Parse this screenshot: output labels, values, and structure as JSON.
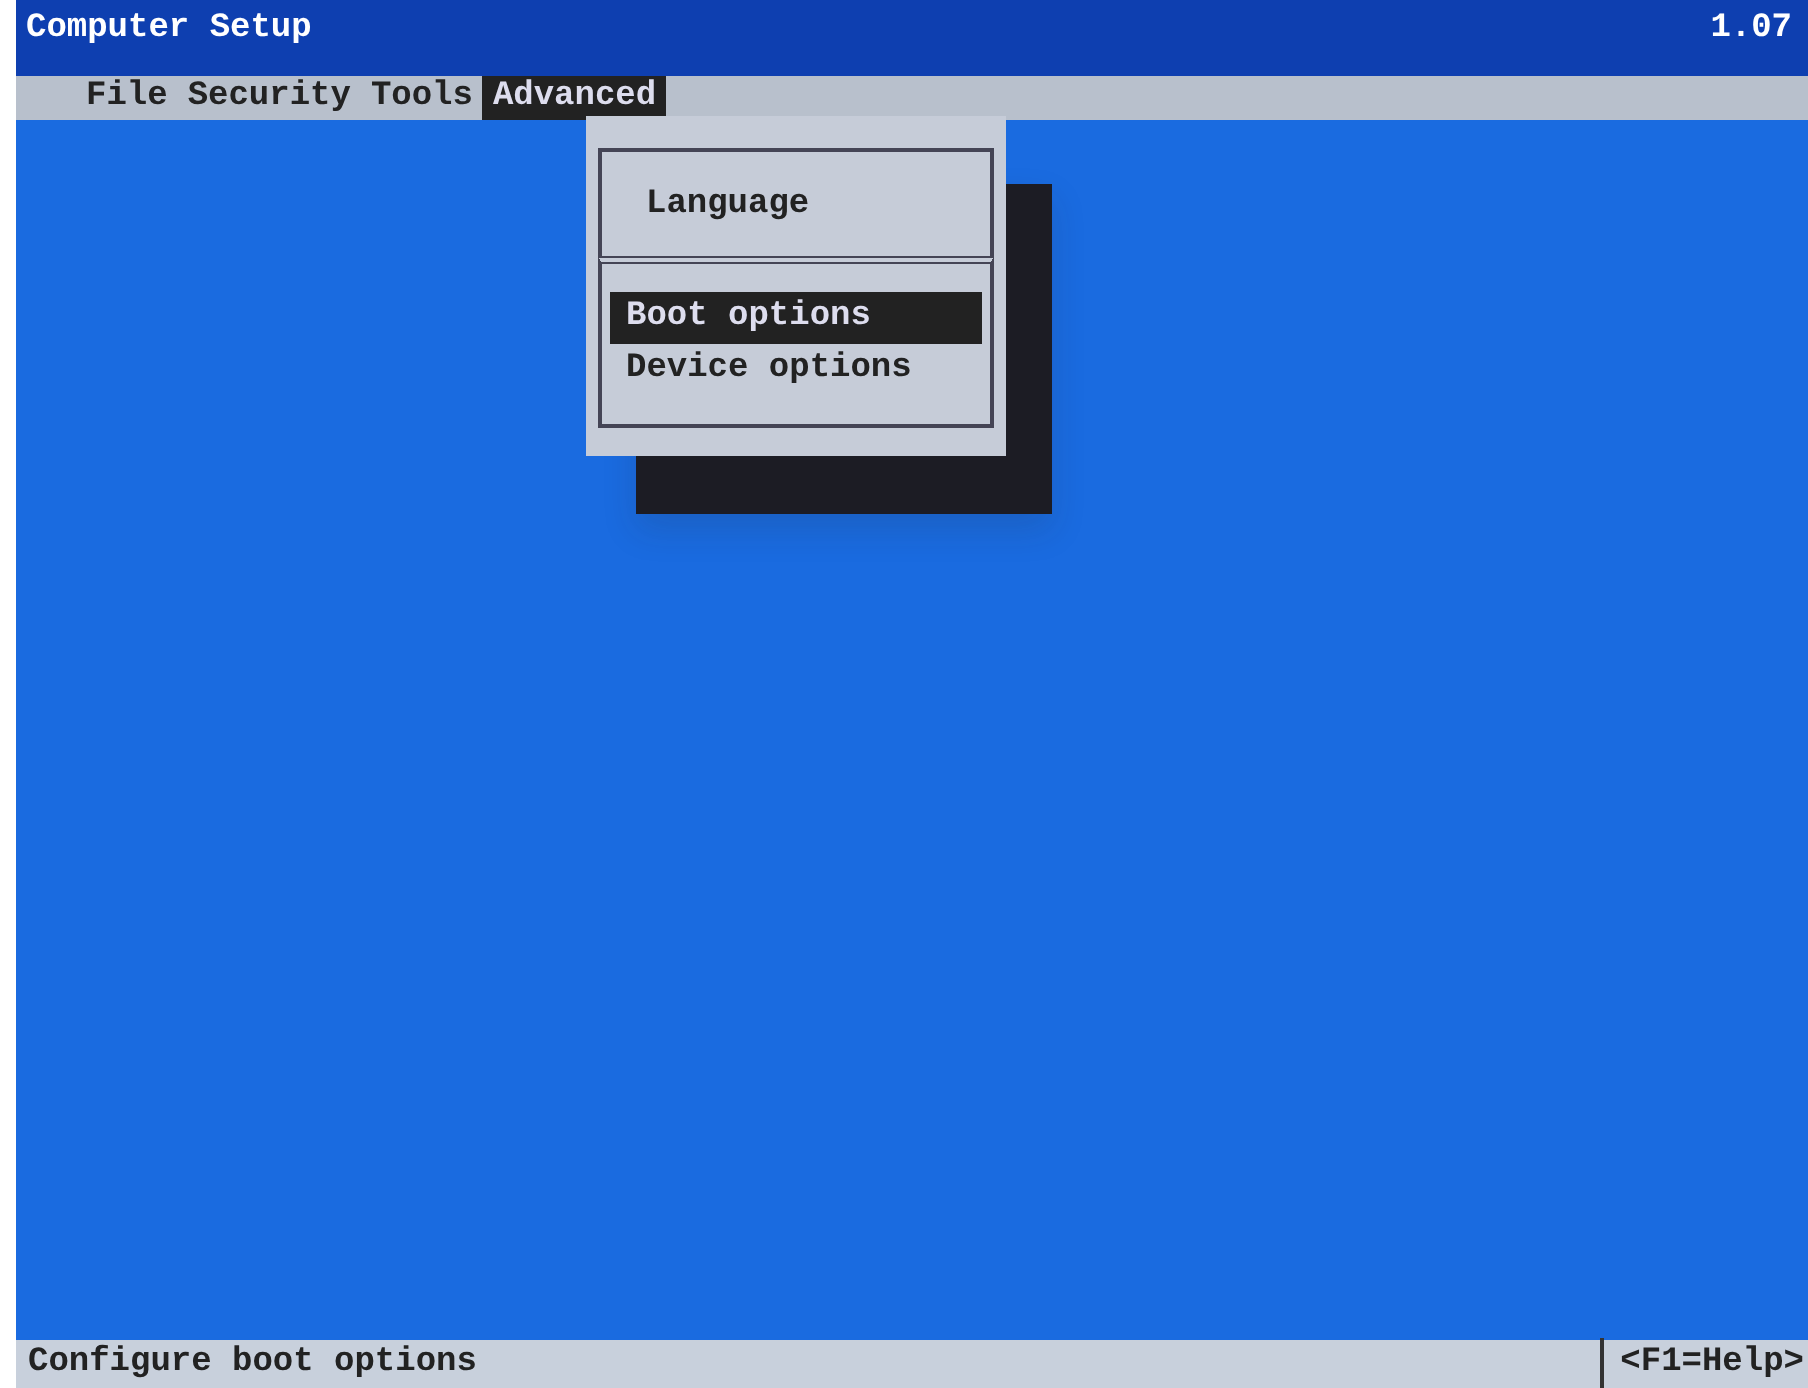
{
  "window": {
    "title": "Computer Setup",
    "version": "1.07"
  },
  "menu_bar": [
    {
      "label": "File",
      "selected": false
    },
    {
      "label": "Security",
      "selected": false
    },
    {
      "label": "Tools",
      "selected": false
    },
    {
      "label": "Advanced",
      "selected": true
    }
  ],
  "dropdown": {
    "groups": [
      {
        "items": [
          {
            "label": "Language",
            "selected": false
          }
        ]
      },
      {
        "items": [
          {
            "label": "Boot options",
            "selected": true
          },
          {
            "label": "Device options",
            "selected": false
          }
        ]
      }
    ]
  },
  "status_bar": {
    "message": "Configure boot options",
    "help": "<F1=Help>"
  }
}
